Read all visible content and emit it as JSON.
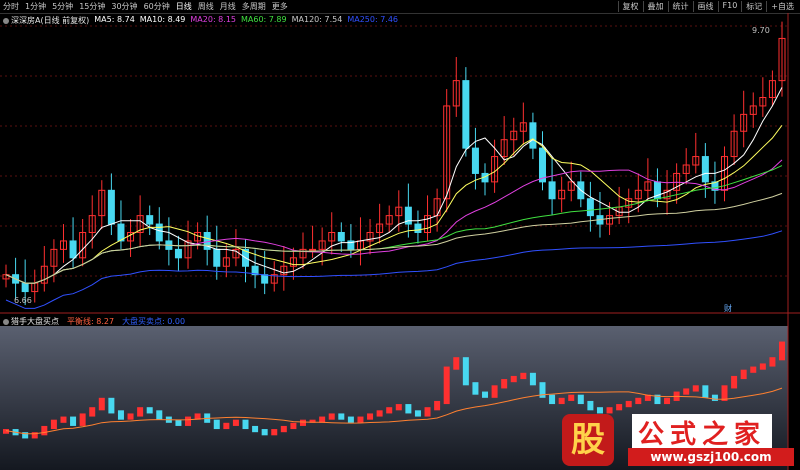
{
  "toolbar": {
    "periods": [
      "分时",
      "1分钟",
      "5分钟",
      "15分钟",
      "30分钟",
      "60分钟",
      "日线",
      "周线",
      "月线",
      "多周期",
      "更多"
    ],
    "active_period": "日线",
    "right_buttons": [
      "叠加",
      "统计",
      "画线",
      "F10",
      "标记",
      "+自选"
    ],
    "first_right": "复权"
  },
  "main": {
    "stock_name": "深深房A(日线 前复权)",
    "ma_legend": [
      {
        "label": "MA5: 8.74",
        "color": "#ffffff"
      },
      {
        "label": "MA10: 8.49",
        "color": "#ffffff"
      },
      {
        "label": "MA20: 8.15",
        "color": "#e040e0"
      },
      {
        "label": "MA60: 7.89",
        "color": "#40e040"
      },
      {
        "label": "MA120: 7.54",
        "color": "#c8c8c8"
      },
      {
        "label": "MA250: 7.46",
        "color": "#3050ff"
      }
    ],
    "high_label": "9.70",
    "low_label": "6.66",
    "marker": "财"
  },
  "sub": {
    "indicator_name": "猎手大盘买点",
    "ref_label": "平衡线: 8.27",
    "ref_label2": "大盘买卖点: 0.00"
  },
  "chart_data": {
    "type": "candlestick",
    "ohlc_close_approx": [
      6.9,
      6.8,
      6.7,
      6.8,
      7.0,
      7.2,
      7.3,
      7.1,
      7.4,
      7.6,
      7.9,
      7.5,
      7.3,
      7.4,
      7.6,
      7.5,
      7.3,
      7.2,
      7.1,
      7.3,
      7.4,
      7.2,
      7.0,
      7.1,
      7.2,
      7.0,
      6.9,
      6.8,
      6.9,
      7.0,
      7.1,
      7.2,
      7.2,
      7.3,
      7.4,
      7.3,
      7.2,
      7.3,
      7.4,
      7.5,
      7.6,
      7.7,
      7.5,
      7.4,
      7.6,
      7.8,
      8.9,
      9.2,
      8.4,
      8.1,
      8.0,
      8.3,
      8.5,
      8.6,
      8.7,
      8.4,
      8.0,
      7.8,
      7.9,
      8.0,
      7.8,
      7.6,
      7.5,
      7.6,
      7.7,
      7.8,
      7.9,
      8.0,
      7.8,
      7.9,
      8.1,
      8.2,
      8.3,
      8.0,
      7.9,
      8.3,
      8.6,
      8.8,
      8.9,
      9.0,
      9.2,
      9.7
    ],
    "ylim": [
      6.6,
      9.8
    ],
    "colors": {
      "up": "#ff3030",
      "down": "#48d8f0",
      "ma5": "#ffffff",
      "ma10": "#ffff60",
      "ma20": "#e040e0",
      "ma60": "#40e040",
      "ma120": "#d0d0a0",
      "ma250": "#3050ff"
    }
  }
}
